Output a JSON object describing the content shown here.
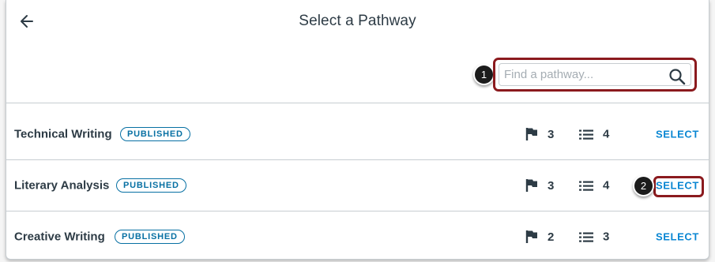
{
  "header": {
    "title": "Select a Pathway",
    "back_icon": "arrow-left-icon"
  },
  "search": {
    "placeholder": "Find a pathway...",
    "value": "",
    "icon": "search-icon"
  },
  "callouts": [
    "1",
    "2"
  ],
  "colors": {
    "accent": "#0b87d3",
    "badge": "#0770a3",
    "highlight": "#8b1a1e",
    "text": "#2d3b45"
  },
  "pathways": [
    {
      "name": "Technical Writing",
      "status": "PUBLISHED",
      "milestones": "3",
      "items": "4",
      "action": "SELECT"
    },
    {
      "name": "Literary Analysis",
      "status": "PUBLISHED",
      "milestones": "3",
      "items": "4",
      "action": "SELECT"
    },
    {
      "name": "Creative Writing",
      "status": "PUBLISHED",
      "milestones": "2",
      "items": "3",
      "action": "SELECT"
    }
  ]
}
